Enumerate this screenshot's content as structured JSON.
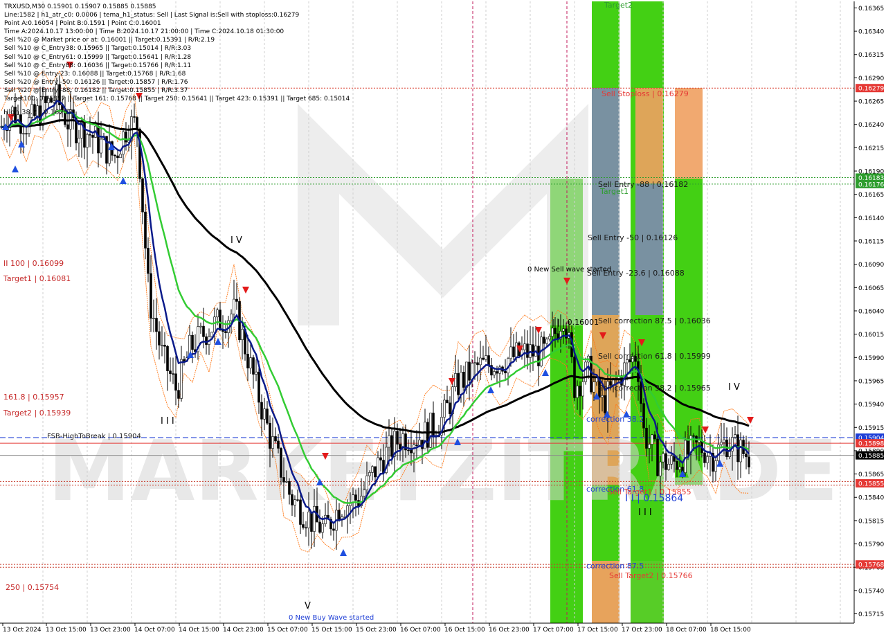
{
  "window": {
    "header_lines": [
      "TRXUSD,M30  0.15901 0.15907 0.15885 0.15885",
      "Line:1582 | h1_atr_c0: 0.0006 | tema_h1_status: Sell | Last Signal is:Sell with stoploss:0.16279",
      "Point A:0.16054 | Point B:0.1591 | Point C:0.16001",
      "Time A:2024.10.17 13:00:00 | Time B:2024.10.17 21:00:00 | Time C:2024.10.18 01:30:00",
      "Sell %20 @ Market price or at: 0.16001 || Target:0.15391 | R/R:2.19",
      "Sell %10 @ C_Entry38: 0.15965 || Target:0.15014 | R/R:3.03",
      "Sell %10 @ C_Entry61: 0.15999 || Target:0.15641 | R/R:1.28",
      "Sell %10 @ C_Entry88: 0.16036 || Target:0.15766 | R/R:1.11",
      "Sell %10 @ Entry-23: 0.16088 || Target:0.15768 | R/R:1.68",
      "Sell %20 @ Entry -50: 0.16126 || Target:0.15857 | R/R:1.76",
      "Sell %20 @ Entry -88: 0.16182 || Target:0.15855 | R/R:3.37",
      "Target100: 0.15857 || Target 161: 0.15768 || Target 250: 0.15641 || Target 423: 0.15391 || Target 685: 0.15014"
    ]
  },
  "chart_data": {
    "type": "candlestick",
    "symbol": "TRXUSD",
    "timeframe": "M30",
    "ylim": [
      0.15705,
      0.16372
    ],
    "y_ticks": [
      "0.16365",
      "0.16340",
      "0.16315",
      "0.16290",
      "0.16265",
      "0.16240",
      "0.16215",
      "0.16190",
      "0.16165",
      "0.16140",
      "0.16115",
      "0.16090",
      "0.16065",
      "0.16040",
      "0.16015",
      "0.15990",
      "0.15965",
      "0.15940",
      "0.15915",
      "0.15890",
      "0.15865",
      "0.15840",
      "0.15815",
      "0.15790",
      "0.15765",
      "0.15740",
      "0.15715"
    ],
    "x_ticks": [
      "13 Oct 2024",
      "13 Oct 15:00",
      "13 Oct 23:00",
      "14 Oct 07:00",
      "14 Oct 15:00",
      "14 Oct 23:00",
      "15 Oct 07:00",
      "15 Oct 15:00",
      "15 Oct 23:00",
      "16 Oct 07:00",
      "16 Oct 15:00",
      "16 Oct 23:00",
      "17 Oct 07:00",
      "17 Oct 15:00",
      "17 Oct 23:00",
      "18 Oct 07:00",
      "18 Oct 15:00"
    ],
    "price_badges": [
      {
        "text": "0.16279",
        "price": 0.16279,
        "color": "#e53935"
      },
      {
        "text": "0.16183",
        "price": 0.16183,
        "color": "#2e9d2e"
      },
      {
        "text": "0.16176",
        "price": 0.16176,
        "color": "#2e9d2e"
      },
      {
        "text": "0.15904",
        "price": 0.15904,
        "color": "#1f3fd6"
      },
      {
        "text": "0.15898",
        "price": 0.15898,
        "color": "#e53935"
      },
      {
        "text": "0.15885",
        "price": 0.15885,
        "color": "#000000"
      },
      {
        "text": "0.15855",
        "price": 0.15855,
        "color": "#e53935"
      },
      {
        "text": "0.15768",
        "price": 0.15768,
        "color": "#e53935"
      }
    ],
    "horizontal_lines": [
      {
        "price": 0.16279,
        "color": "#d83a2a",
        "style": "dotted"
      },
      {
        "price": 0.16183,
        "color": "#2e9d2e",
        "style": "dotted"
      },
      {
        "price": 0.16176,
        "color": "#2e9d2e",
        "style": "dotted"
      },
      {
        "price": 0.15904,
        "color": "#1f3fd6",
        "style": "dashed"
      },
      {
        "price": 0.15898,
        "color": "#e53935",
        "style": "solid"
      },
      {
        "price": 0.15885,
        "color": "#8a8a8a",
        "style": "solid"
      },
      {
        "price": 0.15857,
        "color": "#c83a2a",
        "style": "dotted"
      },
      {
        "price": 0.15853,
        "color": "#c83a2a",
        "style": "dotted"
      },
      {
        "price": 0.15768,
        "color": "#c83a2a",
        "style": "dotted"
      },
      {
        "price": 0.15765,
        "color": "#c83a2a",
        "style": "dotted"
      }
    ],
    "level_labels": [
      {
        "text": "Sell Stoploss | 0.16279",
        "color": "#e53935"
      },
      {
        "text": "Sell Entry -88 | 0.16182",
        "color": "#1a1a1a"
      },
      {
        "text": "Target1",
        "color": "#2e9d2e"
      },
      {
        "text": "Sell Entry -50 | 0.16126",
        "color": "#1a1a1a"
      },
      {
        "text": "Sell Entry -23.6 | 0.16088",
        "color": "#1a1a1a"
      },
      {
        "text": "Sell correction 87.5 | 0.16036",
        "color": "#1a1a1a"
      },
      {
        "text": "Sell correction 61.8 | 0.15999",
        "color": "#1a1a1a"
      },
      {
        "text": "Sell correction 38.2 | 0.15965",
        "color": "#1a1a1a"
      },
      {
        "text": "correction 38.2",
        "color": "#1f3fd6"
      },
      {
        "text": "correction 61.8",
        "color": "#1f3fd6"
      },
      {
        "text": "Sell Target1 | 0.15855",
        "color": "#e53935"
      },
      {
        "text": "I I | 0.15864",
        "color": "#1f3fd6"
      },
      {
        "text": "correction 87.5",
        "color": "#1f3fd6"
      },
      {
        "text": "Sell Target2 | 0.15766",
        "color": "#e53935"
      },
      {
        "text": "Target2",
        "color": "#2e9d2e"
      },
      {
        "text": "0 New Sell wave started",
        "color": "#000000"
      },
      {
        "text": "0 New Buy Wave started",
        "color": "#1f3fd6"
      },
      {
        "text": "| | | 0.16001",
        "color": "#000000"
      },
      {
        "text": "II 100 | 0.16099",
        "color": "#c62828"
      },
      {
        "text": "Target1 | 0.16081",
        "color": "#c62828"
      },
      {
        "text": "161.8 | 0.15957",
        "color": "#c62828"
      },
      {
        "text": "Target2 | 0.15939",
        "color": "#c62828"
      },
      {
        "text": "FSB-HighToBreak | 0.15904",
        "color": "#1a1a1a"
      },
      {
        "text": "250 | 0.15754",
        "color": "#c62828"
      },
      {
        "text": "High 38.2 | 0.16257",
        "color": "#1a1a1a"
      },
      {
        "text": "I V",
        "color": "#000000"
      },
      {
        "text": "I I I",
        "color": "#000000"
      },
      {
        "text": "V",
        "color": "#000000"
      },
      {
        "text": "I I I",
        "color": "#000000"
      },
      {
        "text": "I V",
        "color": "#000000"
      }
    ],
    "watermark": "MARKETZITRADE"
  }
}
